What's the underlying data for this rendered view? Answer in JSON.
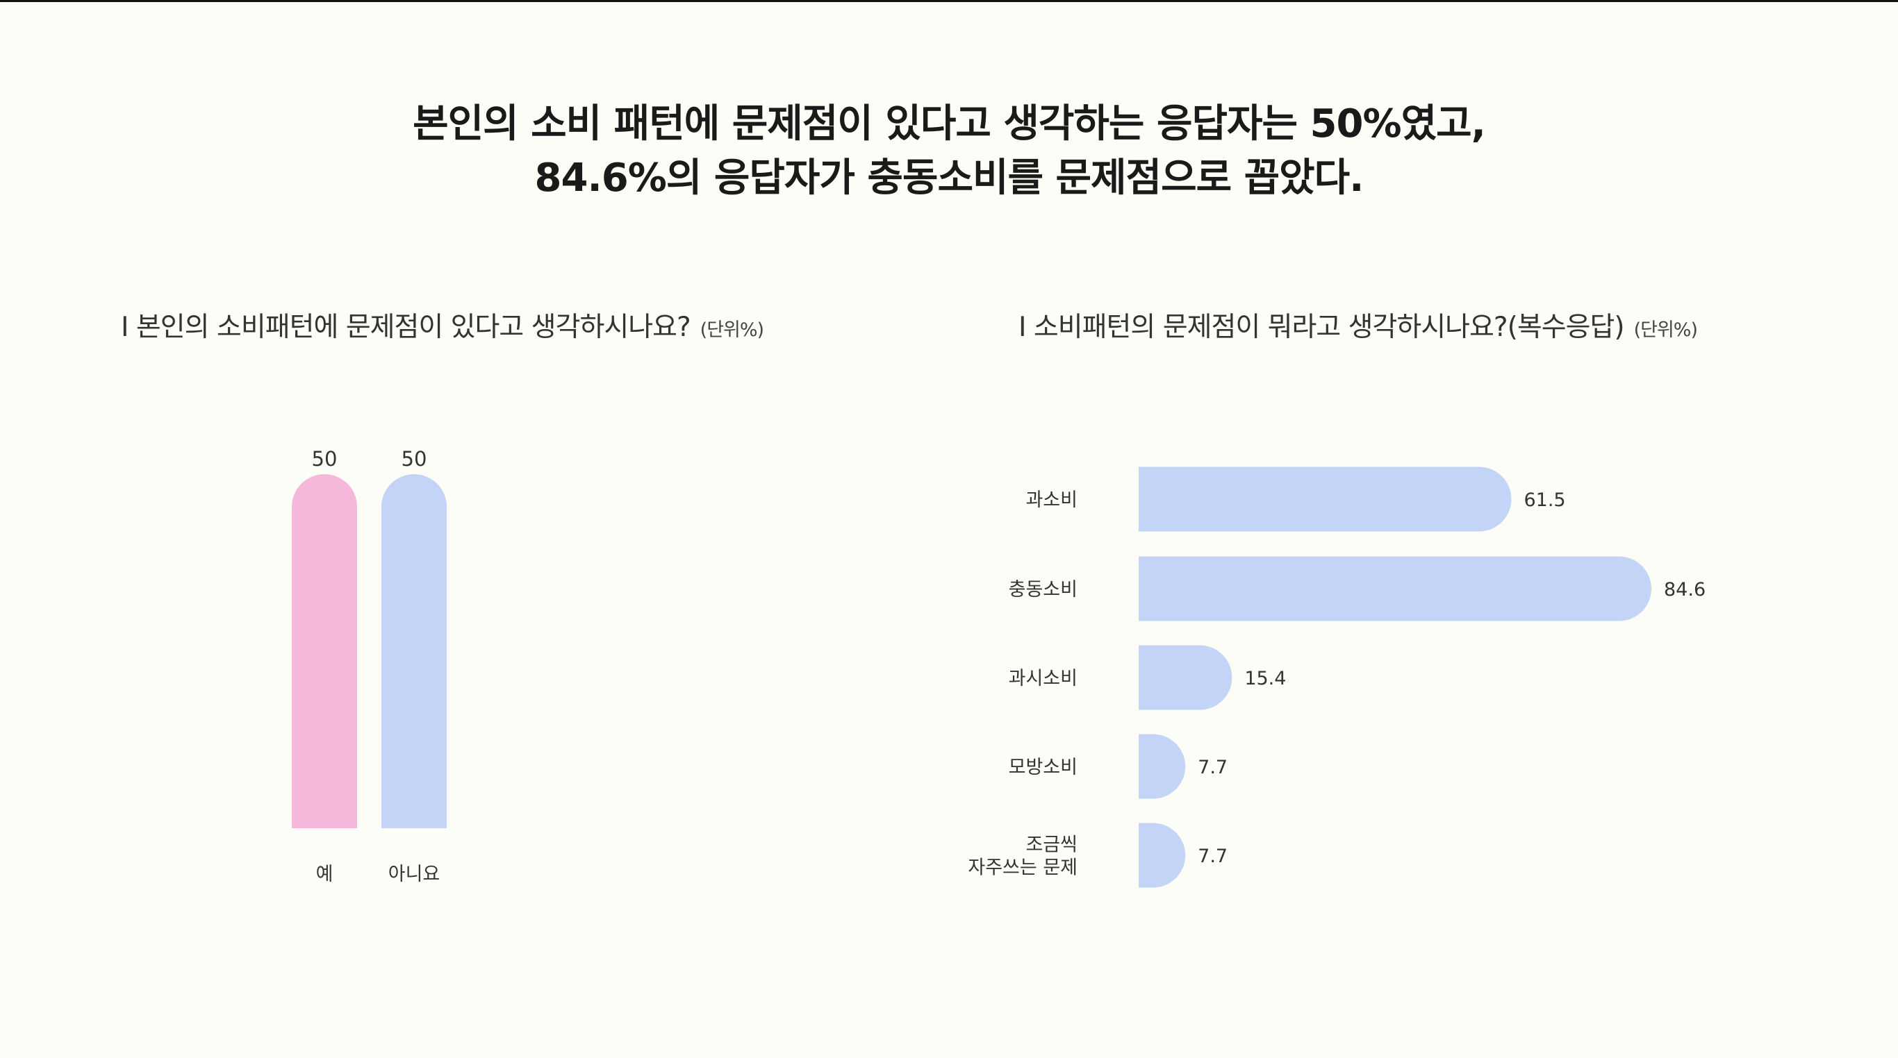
{
  "headline": {
    "line1": "본인의 소비 패턴에 문제점이 있다고 생각하는 응답자는 50%였고,",
    "line2": "84.6%의 응답자가 충동소비를 문제점으로 꼽았다."
  },
  "colors": {
    "background": "#fdfdf8",
    "pink": "#f5b8da",
    "blue": "#c3d4f6"
  },
  "chart_data": [
    {
      "type": "bar",
      "orientation": "vertical",
      "title": "I 본인의 소비패턴에 문제점이 있다고 생각하시나요?",
      "unit": "(단위%)",
      "categories": [
        "예",
        "아니요"
      ],
      "values": [
        50,
        50
      ],
      "value_labels": [
        "50",
        "50"
      ],
      "bar_colors": [
        "#f5b8da",
        "#c3d4f6"
      ],
      "ylim": [
        0,
        50
      ],
      "grid": false
    },
    {
      "type": "bar",
      "orientation": "horizontal",
      "title": "I 소비패턴의 문제점이 뭐라고 생각하시나요?(복수응답)",
      "unit": "(단위%)",
      "categories": [
        [
          "과소비"
        ],
        [
          "충동소비"
        ],
        [
          "과시소비"
        ],
        [
          "모방소비"
        ],
        [
          "조금씩",
          "자주쓰는 문제"
        ]
      ],
      "values": [
        61.5,
        84.6,
        15.4,
        7.7,
        7.7
      ],
      "value_labels": [
        "61.5",
        "84.6",
        "15.4",
        "7.7",
        "7.7"
      ],
      "bar_color": "#c3d4f6",
      "xlim": [
        0,
        84.6
      ],
      "grid": false
    }
  ]
}
